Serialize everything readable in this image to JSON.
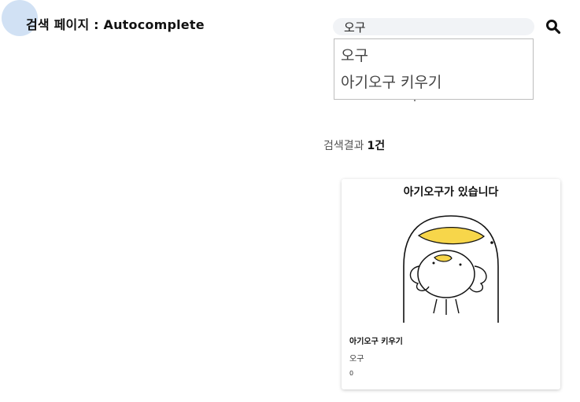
{
  "header": {
    "title": "검색 페이지 : Autocomplete"
  },
  "search": {
    "value": "오구",
    "suggestions": [
      "오구",
      "아기오구 키우기"
    ]
  },
  "results": {
    "label": "검색결과",
    "count": "1건"
  },
  "cards": [
    {
      "image_caption": "아기오구가 있습니다",
      "title": "아기오구 키우기",
      "subtitle": "오구",
      "meta": "0"
    }
  ],
  "colors": {
    "accent_circle": "#c9dcf2",
    "search_bg": "#f1f3f6",
    "duck_bill": "#f7d64a"
  }
}
